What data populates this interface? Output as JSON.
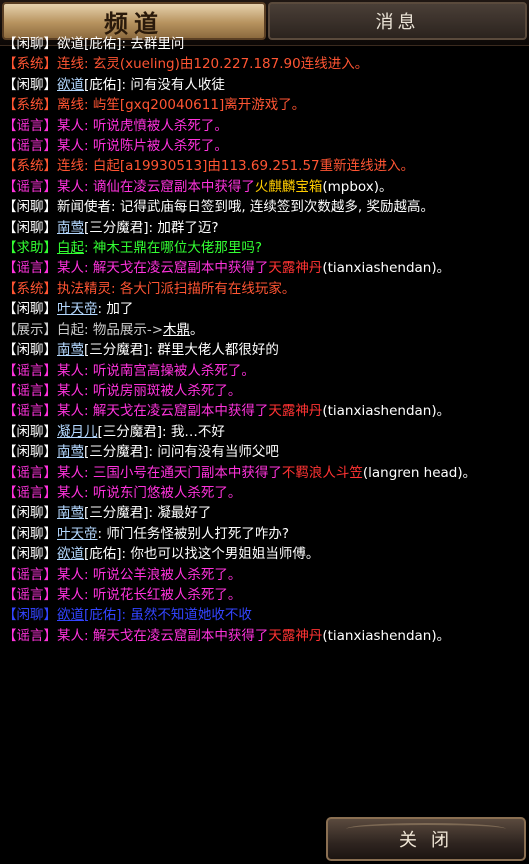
{
  "tabs": {
    "channel": "频道",
    "messages": "消息"
  },
  "colors": {
    "chat": "#ffffff",
    "system": "#ff5533",
    "rumor": "#ff33dd",
    "help": "#33ff33",
    "name": "#b4d8ff",
    "show": "#cccccc",
    "faded": "#3344ff",
    "redItem": "#ff3333",
    "yellowItem": "#ffcc00"
  },
  "messages": [
    {
      "segs": [
        {
          "t": "【闲聊】",
          "c": "chat"
        },
        {
          "t": "欲道[庇佑]: 去群里问",
          "c": "chat"
        }
      ]
    },
    {
      "segs": [
        {
          "t": "【系统】连线: 玄灵(xueling)由120.227.187.90连线进入。",
          "c": "system"
        }
      ]
    },
    {
      "segs": [
        {
          "t": "【闲聊】",
          "c": "chat"
        },
        {
          "t": "欲道",
          "c": "name",
          "u": true
        },
        {
          "t": "[庇佑]: 问有没有人收徒",
          "c": "chat"
        }
      ]
    },
    {
      "segs": [
        {
          "t": "【系统】离线: 屿笙[gxq20040611]离开游戏了。",
          "c": "system"
        }
      ]
    },
    {
      "segs": [
        {
          "t": "【谣言】某人: 听说虎憤被人杀死了。",
          "c": "rumor"
        }
      ]
    },
    {
      "segs": [
        {
          "t": "【谣言】某人: 听说陈片被人杀死了。",
          "c": "rumor"
        }
      ]
    },
    {
      "segs": [
        {
          "t": "【系统】连线: 白起[a19930513]由113.69.251.57重新连线进入。",
          "c": "system"
        }
      ]
    },
    {
      "segs": [
        {
          "t": "【谣言】某人: 谪仙在凌云窟副本中获得了",
          "c": "rumor"
        },
        {
          "t": "火麒麟宝箱",
          "c": "yellowItem"
        },
        {
          "t": "(mpbox)。",
          "c": "chat"
        }
      ]
    },
    {
      "segs": [
        {
          "t": "【闲聊】新闻使者: 记得武庙每日签到哦, 连续签到次数越多, 奖励越高。",
          "c": "chat"
        }
      ]
    },
    {
      "segs": [
        {
          "t": "【闲聊】",
          "c": "chat"
        },
        {
          "t": "南莺",
          "c": "name",
          "u": true
        },
        {
          "t": "[三分魔君]: 加群了迈?",
          "c": "chat"
        }
      ]
    },
    {
      "segs": [
        {
          "t": "【求助】",
          "c": "help"
        },
        {
          "t": "白起",
          "c": "help",
          "u": true
        },
        {
          "t": ": 神木王鼎在哪位大佬那里吗?",
          "c": "help"
        }
      ]
    },
    {
      "segs": [
        {
          "t": "【谣言】某人: 解天戈在凌云窟副本中获得了",
          "c": "rumor"
        },
        {
          "t": "天露神丹",
          "c": "redItem"
        },
        {
          "t": "(tianxiashendan)。",
          "c": "chat"
        }
      ]
    },
    {
      "segs": [
        {
          "t": "【系统】执法精灵: 各大门派扫描所有在线玩家。",
          "c": "system"
        }
      ]
    },
    {
      "segs": [
        {
          "t": "【闲聊】",
          "c": "chat"
        },
        {
          "t": "叶天帝",
          "c": "name",
          "u": true
        },
        {
          "t": ": 加了",
          "c": "chat"
        }
      ]
    },
    {
      "segs": [
        {
          "t": "【展示】白起: 物品展示->",
          "c": "show"
        },
        {
          "t": "木鼎",
          "c": "chat",
          "u": true
        },
        {
          "t": "。",
          "c": "chat"
        }
      ]
    },
    {
      "segs": [
        {
          "t": "【闲聊】",
          "c": "chat"
        },
        {
          "t": "南莺",
          "c": "name",
          "u": true
        },
        {
          "t": "[三分魔君]: 群里大佬人都很好的",
          "c": "chat"
        }
      ]
    },
    {
      "segs": [
        {
          "t": "【谣言】某人: 听说南宫高操被人杀死了。",
          "c": "rumor"
        }
      ]
    },
    {
      "segs": [
        {
          "t": "【谣言】某人: 听说房丽斑被人杀死了。",
          "c": "rumor"
        }
      ]
    },
    {
      "segs": [
        {
          "t": "【谣言】某人: 解天戈在凌云窟副本中获得了",
          "c": "rumor"
        },
        {
          "t": "天露神丹",
          "c": "redItem"
        },
        {
          "t": "(tianxiashendan)。",
          "c": "chat"
        }
      ]
    },
    {
      "segs": [
        {
          "t": "【闲聊】",
          "c": "chat"
        },
        {
          "t": "凝月儿",
          "c": "name",
          "u": true
        },
        {
          "t": "[三分魔君]: 我…不好",
          "c": "chat"
        }
      ]
    },
    {
      "segs": [
        {
          "t": "【闲聊】",
          "c": "chat"
        },
        {
          "t": "南莺",
          "c": "name",
          "u": true
        },
        {
          "t": "[三分魔君]: 问问有没有当师父吧",
          "c": "chat"
        }
      ]
    },
    {
      "segs": [
        {
          "t": "【谣言】某人: 三国小号在通天门副本中获得了",
          "c": "rumor"
        },
        {
          "t": "不羁浪人斗笠",
          "c": "redItem"
        },
        {
          "t": "(langren head)。",
          "c": "chat"
        }
      ]
    },
    {
      "segs": [
        {
          "t": "【谣言】某人: 听说东门悠被人杀死了。",
          "c": "rumor"
        }
      ]
    },
    {
      "segs": [
        {
          "t": "【闲聊】",
          "c": "chat"
        },
        {
          "t": "南莺",
          "c": "name",
          "u": true
        },
        {
          "t": "[三分魔君]: 凝最好了",
          "c": "chat"
        }
      ]
    },
    {
      "segs": [
        {
          "t": "【闲聊】",
          "c": "chat"
        },
        {
          "t": "叶天帝",
          "c": "name",
          "u": true
        },
        {
          "t": ": 师门任务怪被别人打死了咋办?",
          "c": "chat"
        }
      ]
    },
    {
      "segs": [
        {
          "t": "【闲聊】",
          "c": "chat"
        },
        {
          "t": "欲道",
          "c": "name",
          "u": true
        },
        {
          "t": "[庇佑]: 你也可以找这个男姐姐当师傅。",
          "c": "chat"
        }
      ]
    },
    {
      "segs": [
        {
          "t": "【谣言】某人: 听说公羊浪被人杀死了。",
          "c": "rumor"
        }
      ]
    },
    {
      "segs": [
        {
          "t": "【谣言】某人: 听说花长红被人杀死了。",
          "c": "rumor"
        }
      ]
    },
    {
      "segs": [
        {
          "t": "【闲聊】",
          "c": "faded"
        },
        {
          "t": "欲道",
          "c": "faded",
          "u": true
        },
        {
          "t": "[庇佑]: 虽然不知道她收不收",
          "c": "faded"
        }
      ]
    },
    {
      "segs": [
        {
          "t": "【谣言】某人: 解天戈在凌云窟副本中获得了",
          "c": "rumor"
        },
        {
          "t": "天露神丹",
          "c": "redItem"
        },
        {
          "t": "(tianxiashendan)。",
          "c": "chat"
        }
      ]
    }
  ],
  "closeButton": {
    "label": "关闭"
  }
}
